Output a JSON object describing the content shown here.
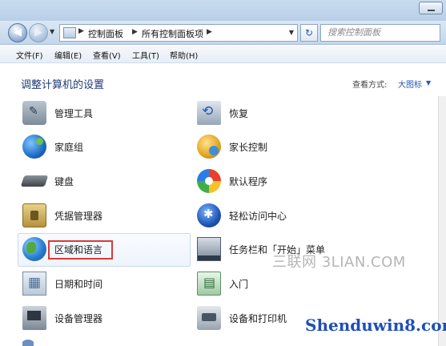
{
  "navigation": {
    "breadcrumb": [
      "控制面板",
      "所有控制面板项"
    ],
    "search_placeholder": "搜索控制面板"
  },
  "menu": [
    "文件(F)",
    "编辑(E)",
    "查看(V)",
    "工具(T)",
    "帮助(H)"
  ],
  "content": {
    "title": "调整计算机的设置",
    "view_by_label": "查看方式:",
    "view_by_value": "大图标"
  },
  "items_left": [
    {
      "label": "管理工具",
      "icon": "administrative-tools-icon"
    },
    {
      "label": "家庭组",
      "icon": "homegroup-icon"
    },
    {
      "label": "键盘",
      "icon": "keyboard-icon"
    },
    {
      "label": "凭据管理器",
      "icon": "credential-manager-icon"
    },
    {
      "label": "区域和语言",
      "icon": "region-language-globe-icon"
    },
    {
      "label": "日期和时间",
      "icon": "date-time-icon"
    },
    {
      "label": "设备管理器",
      "icon": "device-manager-icon"
    }
  ],
  "items_right": [
    {
      "label": "恢复",
      "icon": "recovery-icon"
    },
    {
      "label": "家长控制",
      "icon": "parental-controls-icon"
    },
    {
      "label": "默认程序",
      "icon": "default-programs-icon"
    },
    {
      "label": "轻松访问中心",
      "icon": "ease-of-access-icon"
    },
    {
      "label": "任务栏和「开始」菜单",
      "icon": "taskbar-start-menu-icon"
    },
    {
      "label": "入门",
      "icon": "getting-started-icon"
    },
    {
      "label": "设备和打印机",
      "icon": "devices-printers-icon"
    }
  ],
  "watermarks": {
    "primary": "三联网 3LIAN.COM",
    "secondary": "Shenduwin8.com"
  }
}
